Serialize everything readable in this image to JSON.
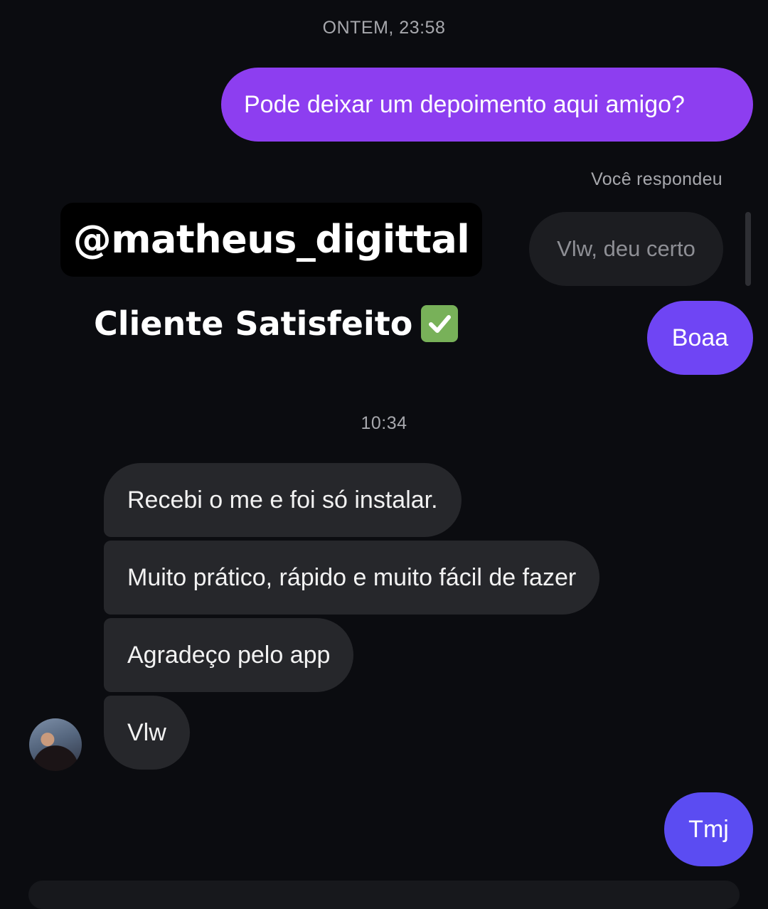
{
  "colors": {
    "background": "#0b0c10",
    "sent_purple": "#8d3ef0",
    "sent_violet": "#6f45f4",
    "sent_indigo": "#5b4cf2",
    "received_bubble": "#26272b",
    "timestamp_text": "#a7a8ad"
  },
  "thread": {
    "timestamp_1": "ONTEM, 23:58",
    "timestamp_2": "10:34"
  },
  "messages": {
    "sent_question": "Pode deixar um depoimento aqui amigo?",
    "reply_label": "Você respondeu",
    "replied_to": "Vlw, deu certo",
    "sent_boaa": "Boaa",
    "received": [
      "Recebi o me e foi só instalar.",
      "Muito prático, rápido e muito fácil de fazer",
      "Agradeço pelo app",
      "Vlw"
    ],
    "sent_tmj": "Tmj"
  },
  "overlay": {
    "handle": "@matheus_digittal",
    "caption": "Cliente Satisfeito",
    "caption_icon": "check-mark-button-icon"
  },
  "avatar": {
    "icon": "contact-avatar"
  }
}
